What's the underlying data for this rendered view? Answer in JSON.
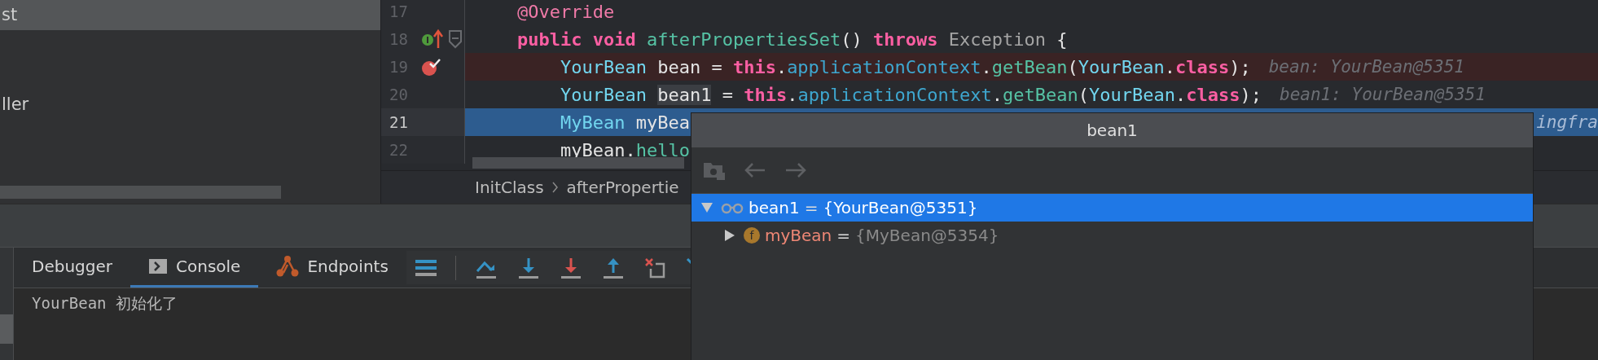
{
  "sidebar": {
    "items": [
      {
        "label": "st",
        "selected": true
      },
      {
        "label": "ller",
        "selected": false
      }
    ]
  },
  "editor": {
    "lines": [
      {
        "number": "17",
        "tokens": [
          {
            "kind": "annotation",
            "text": "    @Override"
          }
        ]
      },
      {
        "number": "18",
        "implements": true,
        "fold": true,
        "tokens": [
          {
            "kind": "keyword",
            "text": "    public void "
          },
          {
            "kind": "method",
            "text": "afterPropertiesSet"
          },
          {
            "kind": "plain",
            "text": "() "
          },
          {
            "kind": "keyword",
            "text": "throws "
          },
          {
            "kind": "class",
            "text": "Exception"
          },
          {
            "kind": "plain",
            "text": " {"
          }
        ]
      },
      {
        "number": "19",
        "breakpoint": true,
        "hint": "bean: YourBean@5351",
        "tokens": [
          {
            "kind": "type",
            "text": "        YourBean"
          },
          {
            "kind": "plain",
            "text": " bean = "
          },
          {
            "kind": "keyword",
            "text": "this"
          },
          {
            "kind": "plain",
            "text": "."
          },
          {
            "kind": "field",
            "text": "applicationContext"
          },
          {
            "kind": "plain",
            "text": "."
          },
          {
            "kind": "method",
            "text": "getBean"
          },
          {
            "kind": "plain",
            "text": "("
          },
          {
            "kind": "type",
            "text": "YourBean"
          },
          {
            "kind": "plain",
            "text": "."
          },
          {
            "kind": "keyword",
            "text": "class"
          },
          {
            "kind": "plain",
            "text": ");"
          }
        ]
      },
      {
        "number": "20",
        "hint": "bean1: YourBean@5351",
        "tokens": [
          {
            "kind": "type",
            "text": "        YourBean "
          },
          {
            "kind": "usage",
            "text": "bean1"
          },
          {
            "kind": "plain",
            "text": " = "
          },
          {
            "kind": "keyword",
            "text": "this"
          },
          {
            "kind": "plain",
            "text": "."
          },
          {
            "kind": "field",
            "text": "applicationContext"
          },
          {
            "kind": "plain",
            "text": "."
          },
          {
            "kind": "method",
            "text": "getBean"
          },
          {
            "kind": "plain",
            "text": "("
          },
          {
            "kind": "type",
            "text": "YourBean"
          },
          {
            "kind": "plain",
            "text": "."
          },
          {
            "kind": "keyword",
            "text": "class"
          },
          {
            "kind": "plain",
            "text": ");"
          }
        ]
      },
      {
        "number": "21",
        "current": true,
        "hint": "ingfra",
        "hint_at_end": true,
        "tokens": [
          {
            "kind": "type",
            "text": "        MyBean"
          },
          {
            "kind": "plain",
            "text": " myBea"
          }
        ]
      },
      {
        "number": "22",
        "tokens": [
          {
            "kind": "plain",
            "text": "        myBean."
          },
          {
            "kind": "method",
            "text": "hello"
          }
        ]
      }
    ]
  },
  "breadcrumbs": [
    "InitClass",
    "afterPropertie"
  ],
  "debug_panel": {
    "tabs": [
      {
        "label": "Debugger",
        "kind": "plain",
        "selected": false
      },
      {
        "label": "Console",
        "kind": "console",
        "selected": true
      },
      {
        "label": "Endpoints",
        "kind": "endpoints",
        "selected": false
      }
    ],
    "console": [
      "YourBean 初始化了"
    ]
  },
  "popup": {
    "title": "bean1",
    "tree": [
      {
        "name": "bean1",
        "operator": "=",
        "value": "{YourBean@5351}",
        "kind": "watch",
        "expanded": true,
        "selected": true,
        "children": [
          {
            "name": "myBean",
            "operator": "=",
            "value": "{MyBean@5354}",
            "kind": "field",
            "badge": "f",
            "expanded": false,
            "selected": false
          }
        ]
      }
    ]
  }
}
